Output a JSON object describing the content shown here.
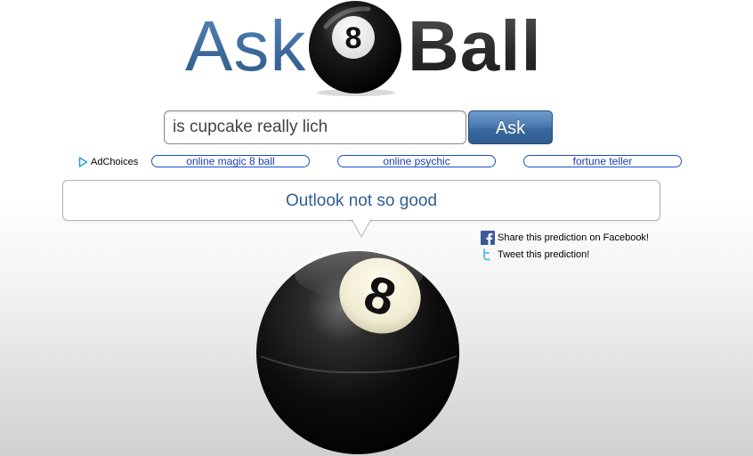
{
  "logo": {
    "ask_text": "Ask",
    "ball_text": "Ball",
    "ball_number": "8"
  },
  "search": {
    "value": "is cupcake really lich",
    "button_label": "Ask"
  },
  "ads": {
    "adchoices_label": "AdChoices",
    "links": [
      {
        "label": "online magic 8 ball"
      },
      {
        "label": "online psychic"
      },
      {
        "label": "fortune teller"
      }
    ]
  },
  "answer": {
    "text": "Outlook not so good"
  },
  "share": {
    "facebook_label": "Share this prediction on Facebook!",
    "twitter_label": "Tweet this prediction!"
  },
  "ball": {
    "number": "8"
  },
  "colors": {
    "accent_blue": "#3e6c9d",
    "answer_text": "#2f5f93",
    "ad_link_border": "#1a4fcf"
  }
}
